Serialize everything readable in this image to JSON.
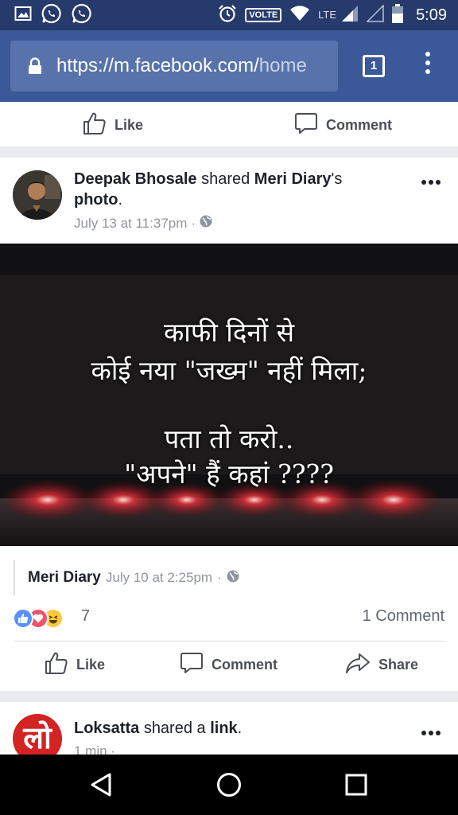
{
  "status_bar": {
    "volte": "VOLTE",
    "network": "LTE",
    "time": "5:09"
  },
  "browser": {
    "url_main": "https://m.facebook.com/",
    "url_dim": "home",
    "tab_count": "1"
  },
  "top_actions": {
    "like": "Like",
    "comment": "Comment"
  },
  "post": {
    "author": "Deepak Bhosale",
    "shared_word": "shared",
    "page_name": "Meri Diary",
    "suffix": "'s",
    "object": "photo",
    "period": ".",
    "timestamp": "July 13 at 11:37pm",
    "separator": "·",
    "image_text": {
      "line1": "काफी दिनों से",
      "line2": "कोई नया \"जख्म\" नहीं मिला;",
      "line3": "पता तो करो..",
      "line4": "\"अपने\" हैं कहां ????"
    },
    "shared_source": {
      "name": "Meri Diary",
      "timestamp": "July 10 at 2:25pm",
      "separator": "·"
    },
    "reactions_count": "7",
    "comments_count": "1 Comment",
    "actions": {
      "like": "Like",
      "comment": "Comment",
      "share": "Share"
    }
  },
  "post2": {
    "author": "Loksatta",
    "shared_text": "shared a",
    "object": "link",
    "period": ".",
    "avatar_glyph": "लो",
    "timestamp": "1 min ·"
  },
  "colors": {
    "facebook_blue": "#3b5998",
    "status_bar": "#263a6b",
    "like_blue": "#5890ff",
    "love_red": "#f25268",
    "haha_yellow": "#fcc93d"
  },
  "icons": [
    "image-icon",
    "whatsapp-icon",
    "alarm-icon",
    "wifi-icon",
    "signal-icon",
    "battery-icon",
    "lock-icon",
    "thumbs-up-icon",
    "comment-icon",
    "share-icon",
    "globe-icon",
    "back-icon",
    "home-icon",
    "recents-icon"
  ]
}
